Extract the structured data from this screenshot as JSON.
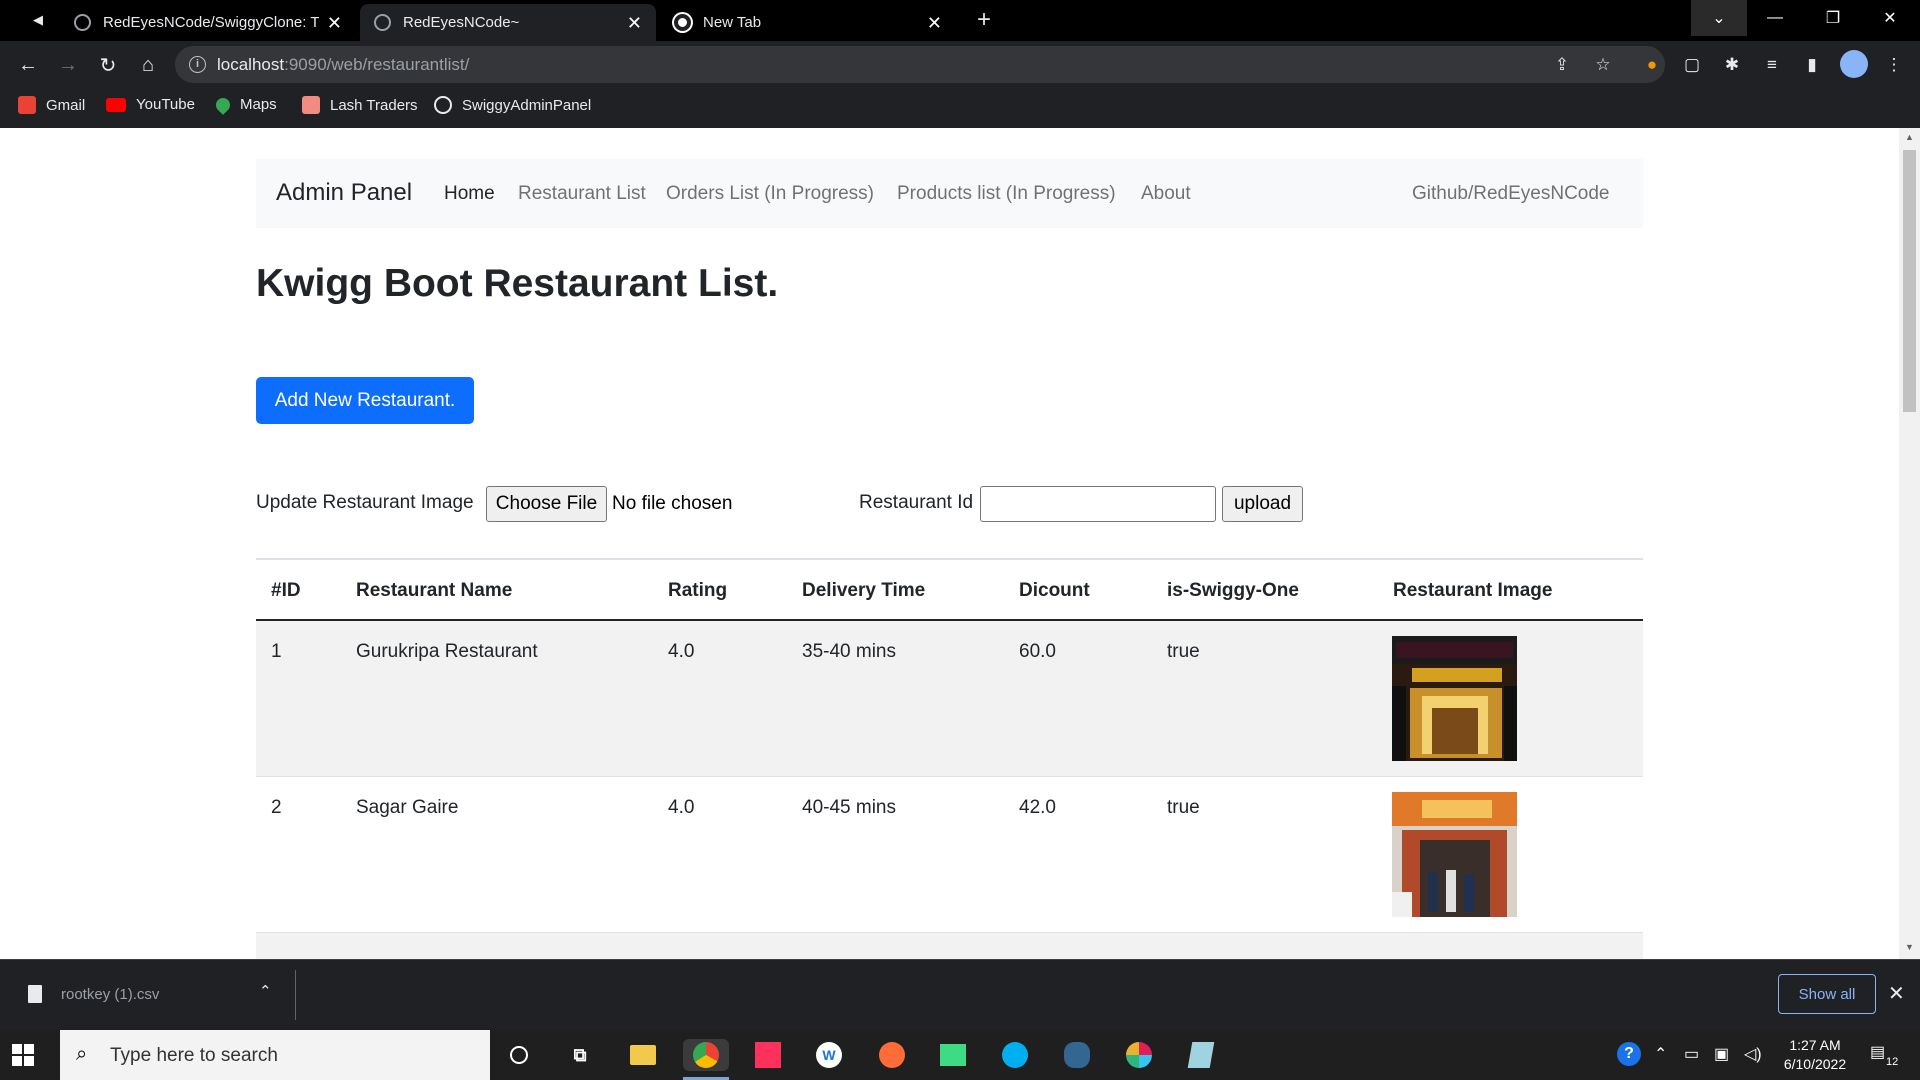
{
  "browser": {
    "tabs": [
      {
        "title": "RedEyesNCode/SwiggyClone: Th",
        "icon": "github-icon"
      },
      {
        "title": "RedEyesNCode~",
        "icon": "globe-icon"
      },
      {
        "title": "New Tab",
        "icon": "chrome-icon"
      }
    ],
    "url_host": "localhost",
    "url_path": ":9090/web/restaurantlist/",
    "bookmarks": [
      "Gmail",
      "YouTube",
      "Maps",
      "Lash Traders",
      "SwiggyAdminPanel"
    ]
  },
  "navbar": {
    "brand": "Admin Panel",
    "links": [
      "Home",
      "Restaurant List",
      "Orders List (In Progress)",
      "Products list (In Progress)",
      "About"
    ],
    "right_link": "Github/RedEyesNCode"
  },
  "page": {
    "title": "Kwigg Boot Restaurant List.",
    "add_button": "Add New Restaurant.",
    "update_label": "Update Restaurant Image",
    "choose_file": "Choose File",
    "no_file": "No file chosen",
    "restaurant_id_label": "Restaurant Id",
    "restaurant_id_value": "",
    "upload_button": "upload"
  },
  "table": {
    "headers": [
      "#ID",
      "Restaurant Name",
      "Rating",
      "Delivery Time",
      "Dicount",
      "is-Swiggy-One",
      "Restaurant Image"
    ],
    "rows": [
      {
        "id": "1",
        "name": "Gurukripa Restaurant",
        "rating": "4.0",
        "delivery": "35-40 mins",
        "discount": "60.0",
        "swiggy_one": "true"
      },
      {
        "id": "2",
        "name": "Sagar Gaire",
        "rating": "4.0",
        "delivery": "40-45 mins",
        "discount": "42.0",
        "swiggy_one": "true"
      }
    ]
  },
  "downloads": {
    "file": "rootkey (1).csv",
    "show_all": "Show all"
  },
  "taskbar": {
    "search_placeholder": "Type here to search",
    "time": "1:27 AM",
    "date": "6/10/2022",
    "notifications": "12"
  },
  "colors": {
    "primary": "#0d6efd",
    "navbar_bg": "#f8f9fa",
    "stripe": "#f2f2f2"
  }
}
